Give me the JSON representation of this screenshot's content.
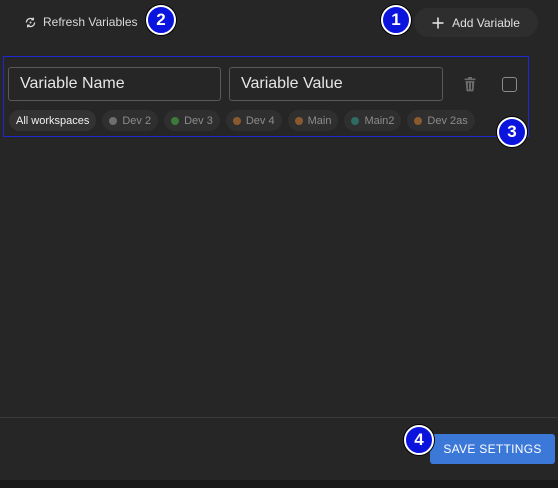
{
  "toolbar": {
    "refresh_label": "Refresh Variables",
    "add_label": "Add Variable"
  },
  "variable_row": {
    "name_placeholder": "Variable Name",
    "value_placeholder": "Variable Value"
  },
  "workspaces": [
    {
      "label": "All workspaces",
      "color": "",
      "active": true
    },
    {
      "label": "Dev 2",
      "color": "#6e6e6e"
    },
    {
      "label": "Dev 3",
      "color": "#3d7a3a"
    },
    {
      "label": "Dev 4",
      "color": "#8a5a2e"
    },
    {
      "label": "Main",
      "color": "#8a5a2e"
    },
    {
      "label": "Main2",
      "color": "#2e6b62"
    },
    {
      "label": "Dev 2as",
      "color": "#8a5a2e"
    }
  ],
  "footer": {
    "save_label": "SAVE SETTINGS"
  },
  "callouts": {
    "add": "1",
    "refresh": "2",
    "row": "3",
    "save": "4"
  },
  "colors": {
    "background": "#262626",
    "accent": "#3b78d8",
    "callout": "#0a14dc"
  }
}
